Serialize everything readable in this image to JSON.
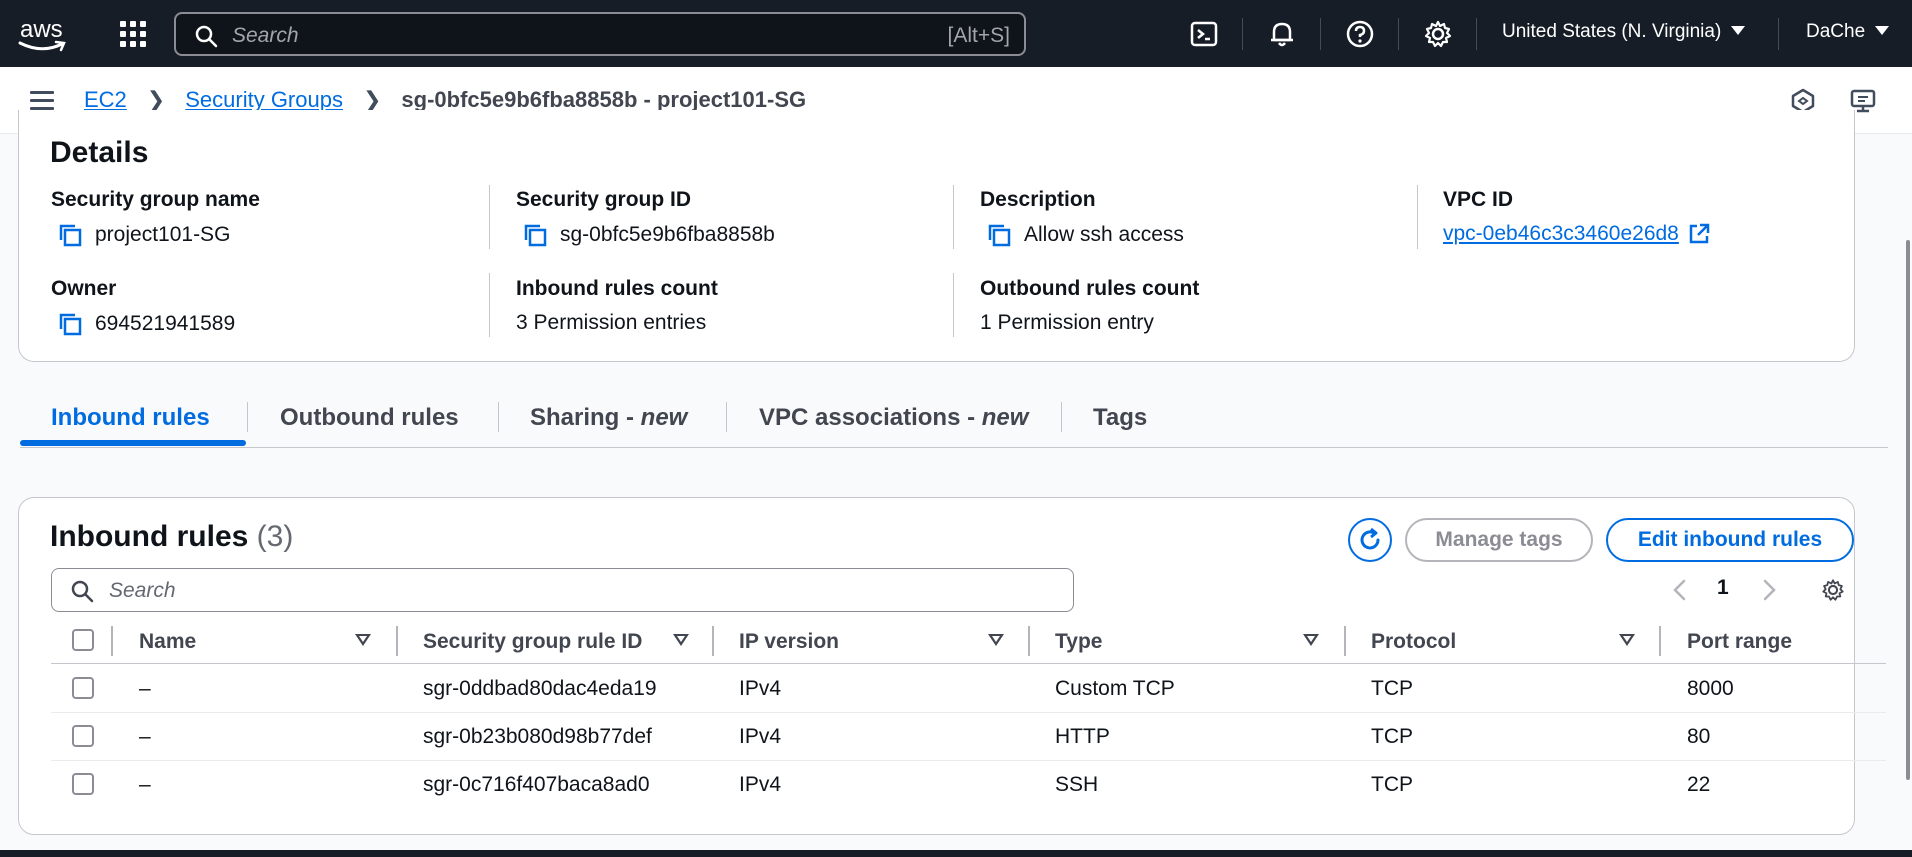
{
  "topnav": {
    "logo_text": "aws",
    "search_placeholder": "Search",
    "search_shortcut": "[Alt+S]",
    "region": "United States (N. Virginia)",
    "user": "DaChe"
  },
  "breadcrumb": {
    "items": [
      "EC2",
      "Security Groups"
    ],
    "current": "sg-0bfc5e9b6fba8858b - project101-SG"
  },
  "details": {
    "title": "Details",
    "sg_name_label": "Security group name",
    "sg_name": "project101-SG",
    "sg_id_label": "Security group ID",
    "sg_id": "sg-0bfc5e9b6fba8858b",
    "description_label": "Description",
    "description": "Allow ssh access",
    "vpc_label": "VPC ID",
    "vpc_id": "vpc-0eb46c3c3460e26d8",
    "owner_label": "Owner",
    "owner": "694521941589",
    "inbound_count_label": "Inbound rules count",
    "inbound_count": "3 Permission entries",
    "outbound_count_label": "Outbound rules count",
    "outbound_count": "1 Permission entry"
  },
  "tabs": [
    {
      "label": "Inbound rules",
      "suffix": ""
    },
    {
      "label": "Outbound rules",
      "suffix": ""
    },
    {
      "label": "Sharing - ",
      "suffix": "new"
    },
    {
      "label": "VPC associations - ",
      "suffix": "new"
    },
    {
      "label": "Tags",
      "suffix": ""
    }
  ],
  "rules": {
    "title": "Inbound rules",
    "count": "(3)",
    "manage_tags": "Manage tags",
    "edit_rules": "Edit inbound rules",
    "search_placeholder": "Search",
    "page": "1",
    "columns": [
      "Name",
      "Security group rule ID",
      "IP version",
      "Type",
      "Protocol",
      "Port range"
    ],
    "rows": [
      {
        "name": "–",
        "rule_id": "sgr-0ddbad80dac4eda19",
        "ip_version": "IPv4",
        "type": "Custom TCP",
        "protocol": "TCP",
        "port_range": "8000"
      },
      {
        "name": "–",
        "rule_id": "sgr-0b23b080d98b77def",
        "ip_version": "IPv4",
        "type": "HTTP",
        "protocol": "TCP",
        "port_range": "80"
      },
      {
        "name": "–",
        "rule_id": "sgr-0c716f407baca8ad0",
        "ip_version": "IPv4",
        "type": "SSH",
        "protocol": "TCP",
        "port_range": "22"
      }
    ]
  },
  "colors": {
    "nav_bg": "#161d26",
    "link": "#006ce0",
    "border": "#c6c6cd"
  }
}
